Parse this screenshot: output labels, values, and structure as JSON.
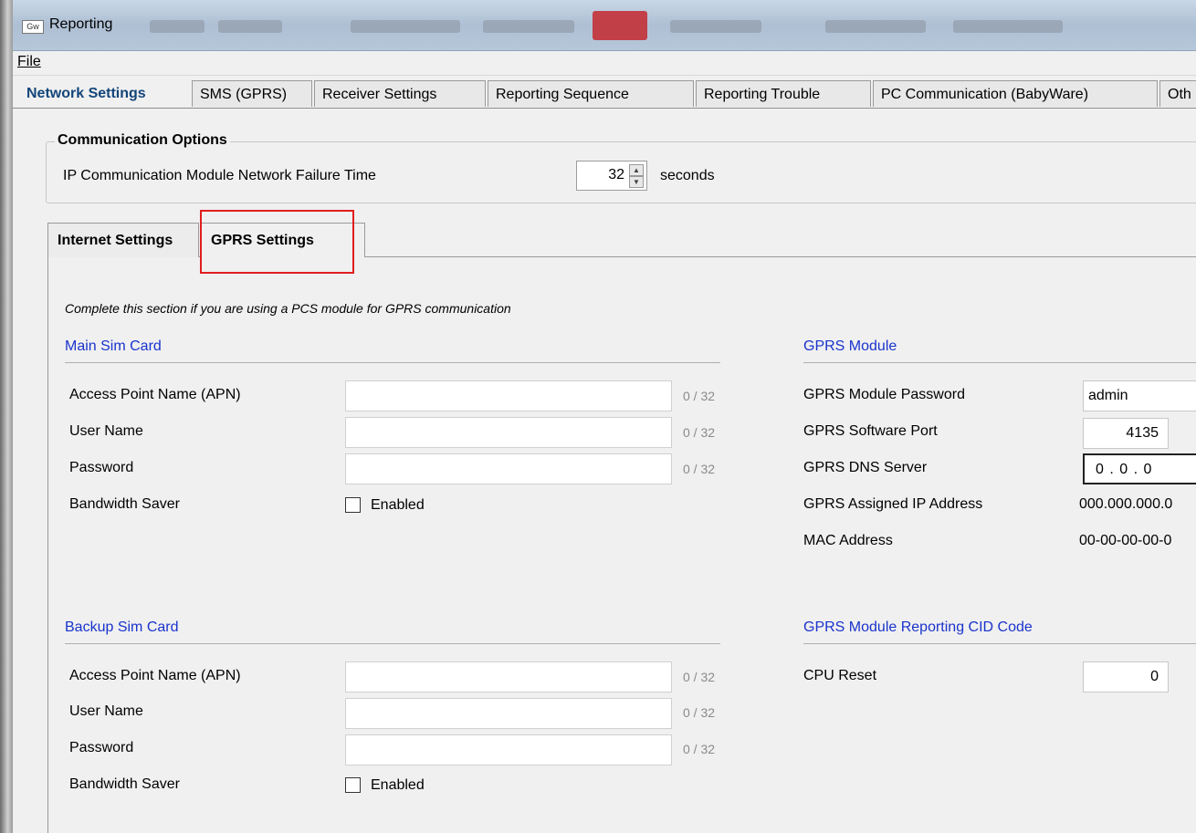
{
  "window": {
    "title": "Reporting",
    "icon_text": "Gw",
    "icon": "app-icon"
  },
  "menu": {
    "file": "File"
  },
  "tabs": [
    {
      "label": "Network Settings",
      "active": true
    },
    {
      "label": "SMS (GPRS)"
    },
    {
      "label": "Receiver Settings"
    },
    {
      "label": "Reporting Sequence"
    },
    {
      "label": "Reporting Trouble"
    },
    {
      "label": "PC Communication (BabyWare)"
    },
    {
      "label": "Oth"
    }
  ],
  "communication_options": {
    "title": "Communication Options",
    "failure_time_label": "IP Communication Module Network Failure Time",
    "failure_time_value": "32",
    "units": "seconds"
  },
  "subtabs": [
    {
      "label": "Internet Settings"
    },
    {
      "label": "GPRS Settings",
      "active": true
    }
  ],
  "gprs": {
    "hint": "Complete this section if you are using a PCS module for GPRS communication",
    "main_sim": {
      "title": "Main Sim Card",
      "apn_label": "Access Point Name (APN)",
      "apn_value": "",
      "apn_count": "0 / 32",
      "user_label": "User Name",
      "user_value": "",
      "user_count": "0 / 32",
      "password_label": "Password",
      "password_value": "",
      "password_count": "0 / 32",
      "bandwidth_label": "Bandwidth Saver",
      "enabled_label": "Enabled",
      "enabled": false
    },
    "backup_sim": {
      "title": "Backup Sim Card",
      "apn_label": "Access Point Name (APN)",
      "apn_value": "",
      "apn_count": "0 / 32",
      "user_label": "User Name",
      "user_value": "",
      "user_count": "0 / 32",
      "password_label": "Password",
      "password_value": "",
      "password_count": "0 / 32",
      "bandwidth_label": "Bandwidth Saver",
      "enabled_label": "Enabled",
      "enabled": false
    },
    "module": {
      "title": "GPRS Module",
      "password_label": "GPRS Module Password",
      "password_value": "admin",
      "port_label": "GPRS Software Port",
      "port_value": "4135",
      "dns_label": "GPRS DNS Server",
      "dns_value": "0 . 0 . 0",
      "ip_label": "GPRS Assigned IP Address",
      "ip_value": "000.000.000.0",
      "mac_label": "MAC Address",
      "mac_value": "00-00-00-00-0"
    },
    "cid": {
      "title": "GPRS Module Reporting CID Code",
      "cpu_reset_label": "CPU Reset",
      "cpu_reset_value": "0"
    }
  },
  "colors": {
    "section_title": "#1a33cc",
    "active_tab_text": "#13457a",
    "highlight": "#e01e1e"
  }
}
